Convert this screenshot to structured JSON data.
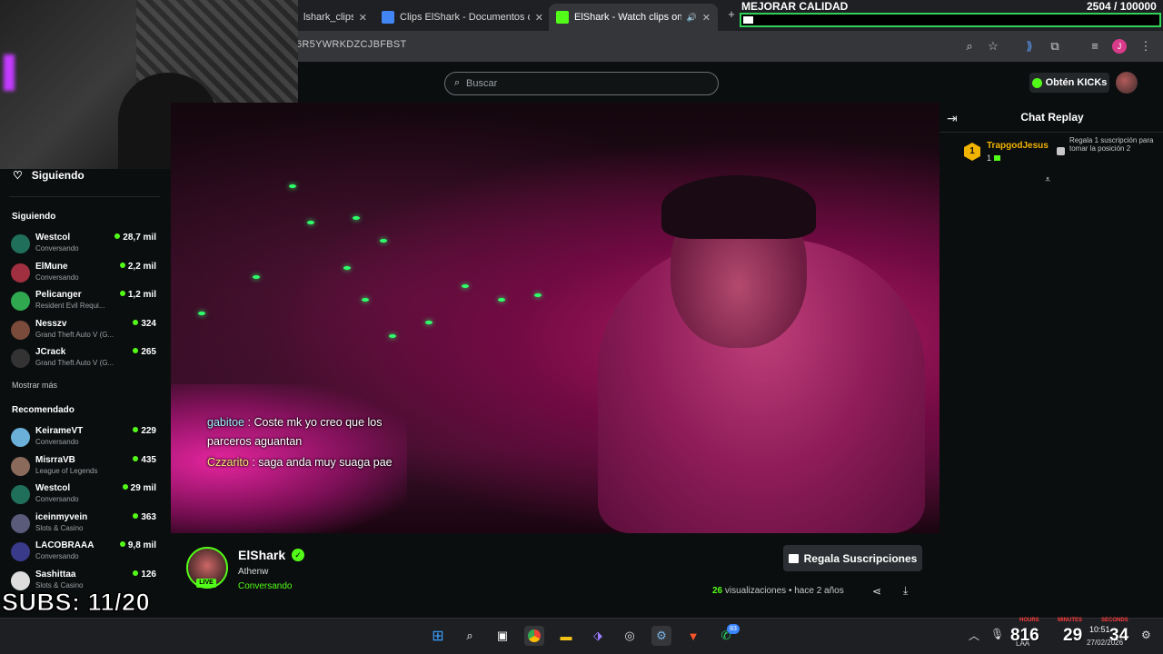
{
  "browser": {
    "tabs": [
      {
        "label": "lshark_clips)",
        "favicon_color": "#3b3b3b"
      },
      {
        "label": "Clips ElShark - Documentos de",
        "favicon_color": "#4285f4"
      },
      {
        "label": "ElShark - Watch clips on Kic",
        "favicon_color": "#53fc18"
      }
    ],
    "url": "6R5YWRKDZCJBFBST"
  },
  "overlay_goal": {
    "title": "MEJORAR CALIDAD",
    "count_text": "2504 / 100000",
    "progress": 0.025
  },
  "header": {
    "search_placeholder": "Buscar",
    "kicks_label": "Obtén KICKs"
  },
  "sidebar": {
    "following_header": "Siguiendo",
    "following_title": "Siguiendo",
    "following": [
      {
        "name": "Westcol",
        "sub": "Conversando",
        "viewers": "28,7 mil",
        "avatar_color": "#1f6f5a"
      },
      {
        "name": "ElMune",
        "sub": "Conversando",
        "viewers": "2,2 mil",
        "avatar_color": "#a03040"
      },
      {
        "name": "Pelicanger",
        "sub": "Resident Evil Requi...",
        "viewers": "1,2 mil",
        "avatar_color": "#2fa84f"
      },
      {
        "name": "Nesszv",
        "sub": "Grand Theft Auto V (G...",
        "viewers": "324",
        "avatar_color": "#7a4a3a"
      },
      {
        "name": "JCrack",
        "sub": "Grand Theft Auto V (G...",
        "viewers": "265",
        "avatar_color": "#333333"
      }
    ],
    "show_more": "Mostrar más",
    "recommended_title": "Recomendado",
    "recommended": [
      {
        "name": "KeirameVT",
        "sub": "Conversando",
        "viewers": "229",
        "avatar_color": "#6ab0d8"
      },
      {
        "name": "MisrraVB",
        "sub": "League of Legends",
        "viewers": "435",
        "avatar_color": "#8a6a5a"
      },
      {
        "name": "Westcol",
        "sub": "Conversando",
        "viewers": "29 mil",
        "avatar_color": "#1f6f5a"
      },
      {
        "name": "iceinmyvein",
        "sub": "Slots & Casino",
        "viewers": "363",
        "avatar_color": "#5a5a7a"
      },
      {
        "name": "LACOBRAAA",
        "sub": "Conversando",
        "viewers": "9,8 mil",
        "avatar_color": "#3a3a8a"
      },
      {
        "name": "Sashittaa",
        "sub": "Slots & Casino",
        "viewers": "126",
        "avatar_color": "#dddddd"
      }
    ]
  },
  "video_chat_overlay": [
    {
      "user": "gabitoe",
      "text": ": Coste mk yo creo que los parceros aguantan"
    },
    {
      "user": "Czzarito",
      "text": ": saga anda muy suaga pae"
    }
  ],
  "chat_panel": {
    "title": "Chat Replay",
    "pinned": {
      "rank": "1",
      "name": "TrapgodJesus",
      "count": "1",
      "text": "Regala 1 suscripción para tomar la posición 2"
    }
  },
  "clip": {
    "streamer": "ElShark",
    "live_label": "LIVE",
    "title": "Athenw",
    "category": "Conversando",
    "gift_label": "Regala Suscripciones",
    "views_count": "26",
    "views_label": " visualizaciones",
    "time_ago": " • hace 2 años"
  },
  "subs_overlay": "SUBS: 11/20",
  "taskbar": {
    "notification_count": "83",
    "time": "10:51",
    "date": "27/02/2026",
    "lang": "LAA",
    "timer": {
      "hours": "816",
      "minutes": "29",
      "seconds": "34",
      "hours_label": "HOURS",
      "minutes_label": "MINUTES",
      "seconds_label": "SECONDS"
    }
  }
}
